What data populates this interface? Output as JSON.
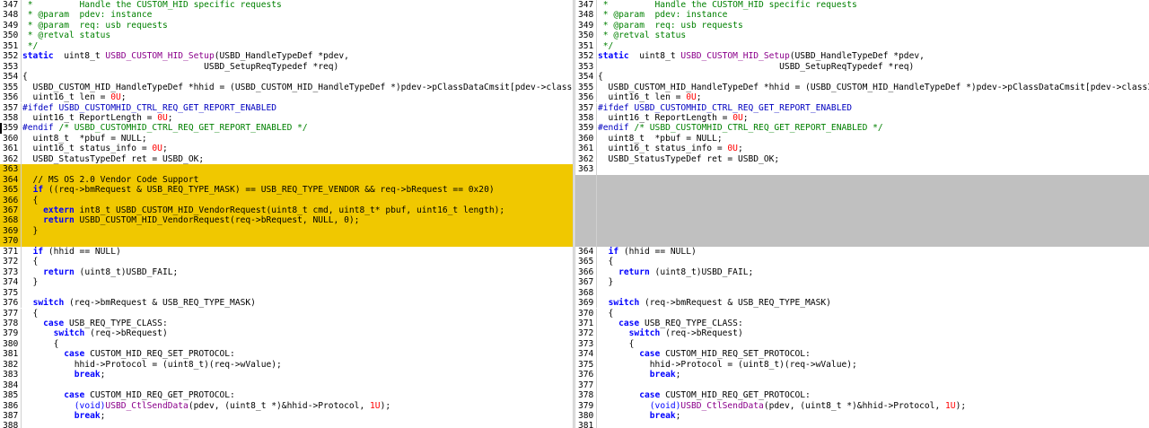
{
  "theme": {
    "changed_bg": "#f0c800",
    "empty_bg": "#c0c0c0",
    "keyword": "#0000ff",
    "function": "#8b008b",
    "number": "#ff0000",
    "comment": "#008000"
  },
  "left": [
    {
      "n": "347",
      "t": [
        [
          "cm",
          " *         Handle the CUSTOM_HID specific requests"
        ]
      ]
    },
    {
      "n": "348",
      "t": [
        [
          "cm",
          " * @param  pdev: instance"
        ]
      ]
    },
    {
      "n": "349",
      "t": [
        [
          "cm",
          " * @param  req: usb requests"
        ]
      ]
    },
    {
      "n": "350",
      "t": [
        [
          "cm",
          " * @retval status"
        ]
      ]
    },
    {
      "n": "351",
      "t": [
        [
          "cm",
          " */"
        ]
      ]
    },
    {
      "n": "352",
      "t": [
        [
          "kw",
          "static"
        ],
        [
          "",
          "  uint8_t "
        ],
        [
          "fn",
          "USBD_CUSTOM_HID_Setup"
        ],
        [
          "",
          "(USBD_HandleTypeDef *pdev,"
        ]
      ]
    },
    {
      "n": "353",
      "t": [
        [
          "",
          "                                   USBD_SetupReqTypedef *req)"
        ]
      ]
    },
    {
      "n": "354",
      "t": [
        [
          "",
          "{"
        ]
      ]
    },
    {
      "n": "355",
      "t": [
        [
          "",
          "  USBD_CUSTOM_HID_HandleTypeDef *hhid = (USBD_CUSTOM_HID_HandleTypeDef *)pdev->pClassDataCmsit[pdev->classI"
        ]
      ]
    },
    {
      "n": "356",
      "t": [
        [
          "",
          "  uint16_t len = "
        ],
        [
          "num",
          "0U"
        ],
        [
          "",
          ";"
        ]
      ]
    },
    {
      "n": "357",
      "t": [
        [
          "pp",
          "#ifdef"
        ],
        [
          "",
          " "
        ],
        [
          "pp",
          "USBD_CUSTOMHID_CTRL_REQ_GET_REPORT_ENABLED"
        ]
      ]
    },
    {
      "n": "358",
      "t": [
        [
          "",
          "  uint16_t ReportLength = "
        ],
        [
          "num",
          "0U"
        ],
        [
          "",
          ";"
        ]
      ]
    },
    {
      "n": "359",
      "t": [
        [
          "pp",
          "#endif"
        ],
        [
          "",
          " "
        ],
        [
          "cm",
          "/* USBD_CUSTOMHID_CTRL_REQ_GET_REPORT_ENABLED */"
        ]
      ],
      "cursor": true
    },
    {
      "n": "360",
      "t": [
        [
          "",
          "  uint8_t  *pbuf = NULL;"
        ]
      ]
    },
    {
      "n": "361",
      "t": [
        [
          "",
          "  uint16_t status_info = "
        ],
        [
          "num",
          "0U"
        ],
        [
          "",
          ";"
        ]
      ]
    },
    {
      "n": "362",
      "t": [
        [
          "",
          "  USBD_StatusTypeDef ret = USBD_OK;"
        ]
      ]
    },
    {
      "n": "363",
      "t": [
        [
          "",
          ""
        ]
      ],
      "hl": "change"
    },
    {
      "n": "364",
      "t": [
        [
          "",
          "  // MS OS 2.0 Vendor Code Support"
        ]
      ],
      "hl": "change"
    },
    {
      "n": "365",
      "t": [
        [
          "",
          "  "
        ],
        [
          "kw",
          "if"
        ],
        [
          "",
          " ((req->bmRequest & USB_REQ_TYPE_MASK) == USB_REQ_TYPE_VENDOR && req->bRequest == 0x20)"
        ]
      ],
      "hl": "change"
    },
    {
      "n": "366",
      "t": [
        [
          "",
          "  {"
        ]
      ],
      "hl": "change"
    },
    {
      "n": "367",
      "t": [
        [
          "",
          "    "
        ],
        [
          "kw",
          "extern"
        ],
        [
          "",
          " int8_t USBD_CUSTOM_HID_VendorRequest(uint8_t cmd, uint8_t* pbuf, uint16_t length);"
        ]
      ],
      "hl": "change"
    },
    {
      "n": "368",
      "t": [
        [
          "",
          "    "
        ],
        [
          "kw",
          "return"
        ],
        [
          "",
          " USBD_CUSTOM_HID_VendorRequest(req->bRequest, NULL, 0);"
        ]
      ],
      "hl": "change"
    },
    {
      "n": "369",
      "t": [
        [
          "",
          "  }"
        ]
      ],
      "hl": "change"
    },
    {
      "n": "370",
      "t": [
        [
          "",
          ""
        ]
      ],
      "hl": "change"
    },
    {
      "n": "371",
      "t": [
        [
          "",
          "  "
        ],
        [
          "kw",
          "if"
        ],
        [
          "",
          " (hhid == NULL)"
        ]
      ]
    },
    {
      "n": "372",
      "t": [
        [
          "",
          "  {"
        ]
      ]
    },
    {
      "n": "373",
      "t": [
        [
          "",
          "    "
        ],
        [
          "kw",
          "return"
        ],
        [
          "",
          " (uint8_t)USBD_FAIL;"
        ]
      ]
    },
    {
      "n": "374",
      "t": [
        [
          "",
          "  }"
        ]
      ]
    },
    {
      "n": "375",
      "t": [
        [
          "",
          ""
        ]
      ]
    },
    {
      "n": "376",
      "t": [
        [
          "",
          "  "
        ],
        [
          "kw",
          "switch"
        ],
        [
          "",
          " (req->bmRequest & USB_REQ_TYPE_MASK)"
        ]
      ]
    },
    {
      "n": "377",
      "t": [
        [
          "",
          "  {"
        ]
      ]
    },
    {
      "n": "378",
      "t": [
        [
          "",
          "    "
        ],
        [
          "kw",
          "case"
        ],
        [
          "",
          " USB_REQ_TYPE_CLASS:"
        ]
      ]
    },
    {
      "n": "379",
      "t": [
        [
          "",
          "      "
        ],
        [
          "kw",
          "switch"
        ],
        [
          "",
          " (req->bRequest)"
        ]
      ]
    },
    {
      "n": "380",
      "t": [
        [
          "",
          "      {"
        ]
      ]
    },
    {
      "n": "381",
      "t": [
        [
          "",
          "        "
        ],
        [
          "kw",
          "case"
        ],
        [
          "",
          " CUSTOM_HID_REQ_SET_PROTOCOL:"
        ]
      ]
    },
    {
      "n": "382",
      "t": [
        [
          "",
          "          hhid->Protocol = (uint8_t)(req->wValue);"
        ]
      ]
    },
    {
      "n": "383",
      "t": [
        [
          "",
          "          "
        ],
        [
          "kw",
          "break"
        ],
        [
          "",
          ";"
        ]
      ]
    },
    {
      "n": "384",
      "t": [
        [
          "",
          ""
        ]
      ]
    },
    {
      "n": "385",
      "t": [
        [
          "",
          "        "
        ],
        [
          "kw",
          "case"
        ],
        [
          "",
          " CUSTOM_HID_REQ_GET_PROTOCOL:"
        ]
      ]
    },
    {
      "n": "386",
      "t": [
        [
          "",
          "          "
        ],
        [
          "ty",
          "(void)"
        ],
        [
          "fn",
          "USBD_CtlSendData"
        ],
        [
          "",
          "(pdev, (uint8_t *)&hhid->Protocol, "
        ],
        [
          "num",
          "1U"
        ],
        [
          "",
          ");"
        ]
      ]
    },
    {
      "n": "387",
      "t": [
        [
          "",
          "          "
        ],
        [
          "kw",
          "break"
        ],
        [
          "",
          ";"
        ]
      ]
    },
    {
      "n": "388",
      "t": [
        [
          "",
          ""
        ]
      ]
    }
  ],
  "right": [
    {
      "n": "347",
      "t": [
        [
          "cm",
          " *         Handle the CUSTOM_HID specific requests"
        ]
      ]
    },
    {
      "n": "348",
      "t": [
        [
          "cm",
          " * @param  pdev: instance"
        ]
      ]
    },
    {
      "n": "349",
      "t": [
        [
          "cm",
          " * @param  req: usb requests"
        ]
      ]
    },
    {
      "n": "350",
      "t": [
        [
          "cm",
          " * @retval status"
        ]
      ]
    },
    {
      "n": "351",
      "t": [
        [
          "cm",
          " */"
        ]
      ]
    },
    {
      "n": "352",
      "t": [
        [
          "kw",
          "static"
        ],
        [
          "",
          "  uint8_t "
        ],
        [
          "fn",
          "USBD_CUSTOM_HID_Setup"
        ],
        [
          "",
          "(USBD_HandleTypeDef *pdev,"
        ]
      ]
    },
    {
      "n": "353",
      "t": [
        [
          "",
          "                                   USBD_SetupReqTypedef *req)"
        ]
      ]
    },
    {
      "n": "354",
      "t": [
        [
          "",
          "{"
        ]
      ]
    },
    {
      "n": "355",
      "t": [
        [
          "",
          "  USBD_CUSTOM_HID_HandleTypeDef *hhid = (USBD_CUSTOM_HID_HandleTypeDef *)pdev->pClassDataCmsit[pdev->classI"
        ]
      ]
    },
    {
      "n": "356",
      "t": [
        [
          "",
          "  uint16_t len = "
        ],
        [
          "num",
          "0U"
        ],
        [
          "",
          ";"
        ]
      ]
    },
    {
      "n": "357",
      "t": [
        [
          "pp",
          "#ifdef"
        ],
        [
          "",
          " "
        ],
        [
          "pp",
          "USBD_CUSTOMHID_CTRL_REQ_GET_REPORT_ENABLED"
        ]
      ]
    },
    {
      "n": "358",
      "t": [
        [
          "",
          "  uint16_t ReportLength = "
        ],
        [
          "num",
          "0U"
        ],
        [
          "",
          ";"
        ]
      ]
    },
    {
      "n": "359",
      "t": [
        [
          "pp",
          "#endif"
        ],
        [
          "",
          " "
        ],
        [
          "cm",
          "/* USBD_CUSTOMHID_CTRL_REQ_GET_REPORT_ENABLED */"
        ]
      ]
    },
    {
      "n": "360",
      "t": [
        [
          "",
          "  uint8_t  *pbuf = NULL;"
        ]
      ]
    },
    {
      "n": "361",
      "t": [
        [
          "",
          "  uint16_t status_info = "
        ],
        [
          "num",
          "0U"
        ],
        [
          "",
          ";"
        ]
      ]
    },
    {
      "n": "362",
      "t": [
        [
          "",
          "  USBD_StatusTypeDef ret = USBD_OK;"
        ]
      ]
    },
    {
      "n": "363",
      "t": [
        [
          "",
          ""
        ]
      ]
    },
    {
      "n": "",
      "t": [
        [
          "",
          ""
        ]
      ],
      "hl": "empty"
    },
    {
      "n": "",
      "t": [
        [
          "",
          ""
        ]
      ],
      "hl": "empty"
    },
    {
      "n": "",
      "t": [
        [
          "",
          ""
        ]
      ],
      "hl": "empty"
    },
    {
      "n": "",
      "t": [
        [
          "",
          ""
        ]
      ],
      "hl": "empty"
    },
    {
      "n": "",
      "t": [
        [
          "",
          ""
        ]
      ],
      "hl": "empty"
    },
    {
      "n": "",
      "t": [
        [
          "",
          ""
        ]
      ],
      "hl": "empty"
    },
    {
      "n": "",
      "t": [
        [
          "",
          ""
        ]
      ],
      "hl": "empty"
    },
    {
      "n": "364",
      "t": [
        [
          "",
          "  "
        ],
        [
          "kw",
          "if"
        ],
        [
          "",
          " (hhid == NULL)"
        ]
      ]
    },
    {
      "n": "365",
      "t": [
        [
          "",
          "  {"
        ]
      ]
    },
    {
      "n": "366",
      "t": [
        [
          "",
          "    "
        ],
        [
          "kw",
          "return"
        ],
        [
          "",
          " (uint8_t)USBD_FAIL;"
        ]
      ]
    },
    {
      "n": "367",
      "t": [
        [
          "",
          "  }"
        ]
      ]
    },
    {
      "n": "368",
      "t": [
        [
          "",
          ""
        ]
      ]
    },
    {
      "n": "369",
      "t": [
        [
          "",
          "  "
        ],
        [
          "kw",
          "switch"
        ],
        [
          "",
          " (req->bmRequest & USB_REQ_TYPE_MASK)"
        ]
      ]
    },
    {
      "n": "370",
      "t": [
        [
          "",
          "  {"
        ]
      ]
    },
    {
      "n": "371",
      "t": [
        [
          "",
          "    "
        ],
        [
          "kw",
          "case"
        ],
        [
          "",
          " USB_REQ_TYPE_CLASS:"
        ]
      ]
    },
    {
      "n": "372",
      "t": [
        [
          "",
          "      "
        ],
        [
          "kw",
          "switch"
        ],
        [
          "",
          " (req->bRequest)"
        ]
      ]
    },
    {
      "n": "373",
      "t": [
        [
          "",
          "      {"
        ]
      ]
    },
    {
      "n": "374",
      "t": [
        [
          "",
          "        "
        ],
        [
          "kw",
          "case"
        ],
        [
          "",
          " CUSTOM_HID_REQ_SET_PROTOCOL:"
        ]
      ]
    },
    {
      "n": "375",
      "t": [
        [
          "",
          "          hhid->Protocol = (uint8_t)(req->wValue);"
        ]
      ]
    },
    {
      "n": "376",
      "t": [
        [
          "",
          "          "
        ],
        [
          "kw",
          "break"
        ],
        [
          "",
          ";"
        ]
      ]
    },
    {
      "n": "377",
      "t": [
        [
          "",
          ""
        ]
      ]
    },
    {
      "n": "378",
      "t": [
        [
          "",
          "        "
        ],
        [
          "kw",
          "case"
        ],
        [
          "",
          " CUSTOM_HID_REQ_GET_PROTOCOL:"
        ]
      ]
    },
    {
      "n": "379",
      "t": [
        [
          "",
          "          "
        ],
        [
          "ty",
          "(void)"
        ],
        [
          "fn",
          "USBD_CtlSendData"
        ],
        [
          "",
          "(pdev, (uint8_t *)&hhid->Protocol, "
        ],
        [
          "num",
          "1U"
        ],
        [
          "",
          ");"
        ]
      ]
    },
    {
      "n": "380",
      "t": [
        [
          "",
          "          "
        ],
        [
          "kw",
          "break"
        ],
        [
          "",
          ";"
        ]
      ]
    },
    {
      "n": "381",
      "t": [
        [
          "",
          ""
        ]
      ]
    }
  ]
}
